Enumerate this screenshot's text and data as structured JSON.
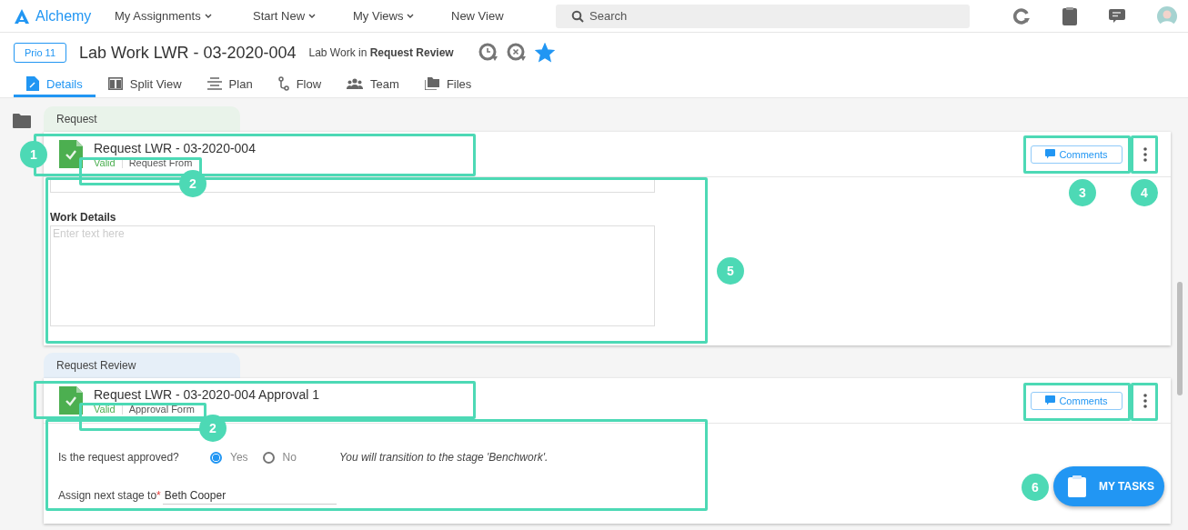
{
  "app": {
    "name": "Alchemy"
  },
  "nav": [
    {
      "label": "My Assignments",
      "dropdown": true
    },
    {
      "label": "Start New",
      "dropdown": true
    },
    {
      "label": "My Views",
      "dropdown": true
    },
    {
      "label": "New View",
      "dropdown": false
    }
  ],
  "search": {
    "placeholder": "Search"
  },
  "record": {
    "priority": "Prio 11",
    "title": "Lab Work LWR - 03-2020-004",
    "subtitle": "Lab Work in **Request Review**",
    "favorite": true
  },
  "tabs": [
    {
      "label": "Details",
      "kind": "doc",
      "selected": true
    },
    {
      "label": "Split View",
      "kind": "split",
      "selected": false
    },
    {
      "label": "Plan",
      "kind": "plan",
      "selected": false
    },
    {
      "label": "Flow",
      "kind": "flow",
      "selected": false
    },
    {
      "label": "Team",
      "kind": "team",
      "selected": false
    },
    {
      "label": "Files",
      "kind": "files",
      "selected": false
    }
  ],
  "sections": [
    {
      "label": "Request",
      "color": "#e9f3ea",
      "card": {
        "title": "Request LWR - 03-2020-004",
        "status": "Valid",
        "form": "Request From",
        "comments": "Comments",
        "fields": [
          {
            "kind": "cut-input"
          },
          {
            "kind": "textarea",
            "label": "Work Details",
            "placeholder": "Enter text here"
          }
        ]
      }
    },
    {
      "label": "Request Review",
      "color": "#e6eff8",
      "card": {
        "title": "Request LWR - 03-2020-004 Approval 1",
        "status": "Valid",
        "form": "Approval Form",
        "comments": "Comments",
        "fields": [
          {
            "kind": "radio",
            "label": "Is the request approved?",
            "options": [
              {
                "label": "Yes",
                "selected": true
              },
              {
                "label": "No",
                "selected": false
              }
            ],
            "note": "You will transition to the stage 'Benchwork'."
          },
          {
            "kind": "person",
            "label": "Assign next stage to",
            "required_mark": "*",
            "value": "Beth Cooper"
          }
        ]
      }
    }
  ],
  "fab": {
    "label": "MY TASKS"
  },
  "callouts": [
    {
      "label": "1"
    },
    {
      "label": "2"
    },
    {
      "label": "3"
    },
    {
      "label": "4"
    },
    {
      "label": "5"
    },
    {
      "label": "2"
    },
    {
      "label": "6"
    }
  ]
}
